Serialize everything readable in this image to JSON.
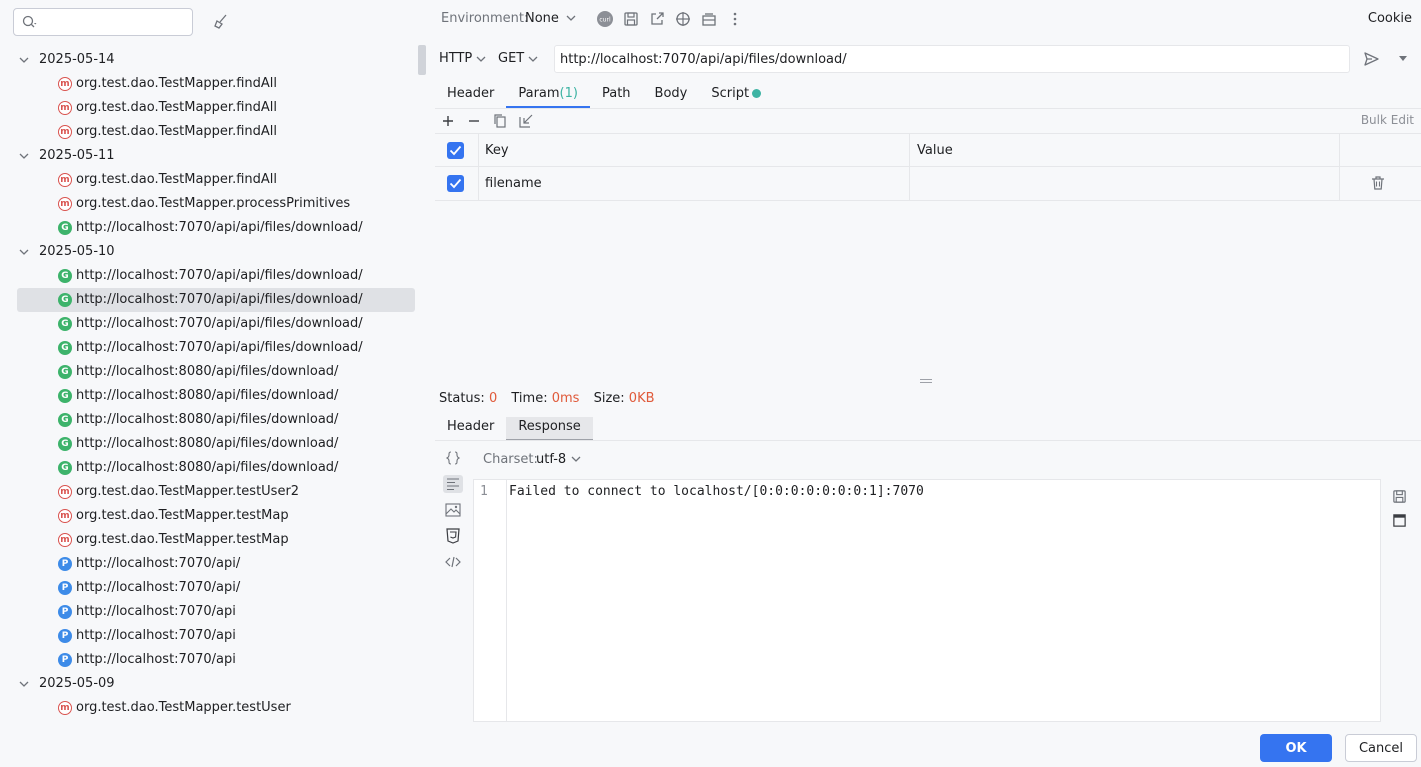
{
  "search": {
    "placeholder": ""
  },
  "history": [
    {
      "date": "2025-05-14",
      "items": [
        {
          "type": "m",
          "label": "org.test.dao.TestMapper.findAll"
        },
        {
          "type": "m",
          "label": "org.test.dao.TestMapper.findAll"
        },
        {
          "type": "m",
          "label": "org.test.dao.TestMapper.findAll"
        }
      ]
    },
    {
      "date": "2025-05-11",
      "items": [
        {
          "type": "m",
          "label": "org.test.dao.TestMapper.findAll"
        },
        {
          "type": "m",
          "label": "org.test.dao.TestMapper.processPrimitives"
        },
        {
          "type": "g",
          "label": "http://localhost:7070/api/api/files/download/"
        }
      ]
    },
    {
      "date": "2025-05-10",
      "items": [
        {
          "type": "g",
          "label": "http://localhost:7070/api/api/files/download/"
        },
        {
          "type": "g",
          "label": "http://localhost:7070/api/api/files/download/",
          "selected": true
        },
        {
          "type": "g",
          "label": "http://localhost:7070/api/api/files/download/"
        },
        {
          "type": "g",
          "label": "http://localhost:7070/api/api/files/download/"
        },
        {
          "type": "g",
          "label": "http://localhost:8080/api/files/download/"
        },
        {
          "type": "g",
          "label": "http://localhost:8080/api/files/download/"
        },
        {
          "type": "g",
          "label": "http://localhost:8080/api/files/download/"
        },
        {
          "type": "g",
          "label": "http://localhost:8080/api/files/download/"
        },
        {
          "type": "g",
          "label": "http://localhost:8080/api/files/download/"
        },
        {
          "type": "m",
          "label": "org.test.dao.TestMapper.testUser2"
        },
        {
          "type": "m",
          "label": "org.test.dao.TestMapper.testMap"
        },
        {
          "type": "m",
          "label": "org.test.dao.TestMapper.testMap"
        },
        {
          "type": "p",
          "label": "http://localhost:7070/api/"
        },
        {
          "type": "p",
          "label": "http://localhost:7070/api/"
        },
        {
          "type": "p",
          "label": "http://localhost:7070/api"
        },
        {
          "type": "p",
          "label": "http://localhost:7070/api"
        },
        {
          "type": "p",
          "label": "http://localhost:7070/api"
        }
      ]
    },
    {
      "date": "2025-05-09",
      "items": [
        {
          "type": "m",
          "label": "org.test.dao.TestMapper.testUser"
        }
      ]
    }
  ],
  "badges": {
    "m": "m",
    "g": "G",
    "p": "P"
  },
  "toolbar": {
    "env_label": "Environment:",
    "env_value": "None",
    "curl_icon_text": "curl",
    "cookie": "Cookie"
  },
  "request": {
    "protocol": "HTTP",
    "method": "GET",
    "url": "http://localhost:7070/api/api/files/download/"
  },
  "tabs": {
    "header": "Header",
    "param": "Param",
    "param_count": "(1)",
    "path": "Path",
    "body": "Body",
    "script": "Script"
  },
  "params": {
    "bulk_edit": "Bulk Edit",
    "col_key": "Key",
    "col_value": "Value",
    "rows": [
      {
        "key": "filename",
        "value": ""
      }
    ]
  },
  "status": {
    "status_label": "Status:",
    "status_value": "0",
    "time_label": "Time:",
    "time_value": "0ms",
    "size_label": "Size:",
    "size_value": "0KB"
  },
  "response_tabs": {
    "header": "Header",
    "response": "Response"
  },
  "charset": {
    "label": "Charset:",
    "value": "utf-8"
  },
  "editor": {
    "line_number": "1",
    "text": "Failed to connect to localhost/[0:0:0:0:0:0:0:1]:7070"
  },
  "buttons": {
    "ok": "OK",
    "cancel": "Cancel"
  },
  "colors": {
    "accent": "#3574f0",
    "method_badge": "#d9534f",
    "get_badge": "#3db36b",
    "post_badge": "#3d8be8",
    "status_value": "#e05a3a"
  }
}
